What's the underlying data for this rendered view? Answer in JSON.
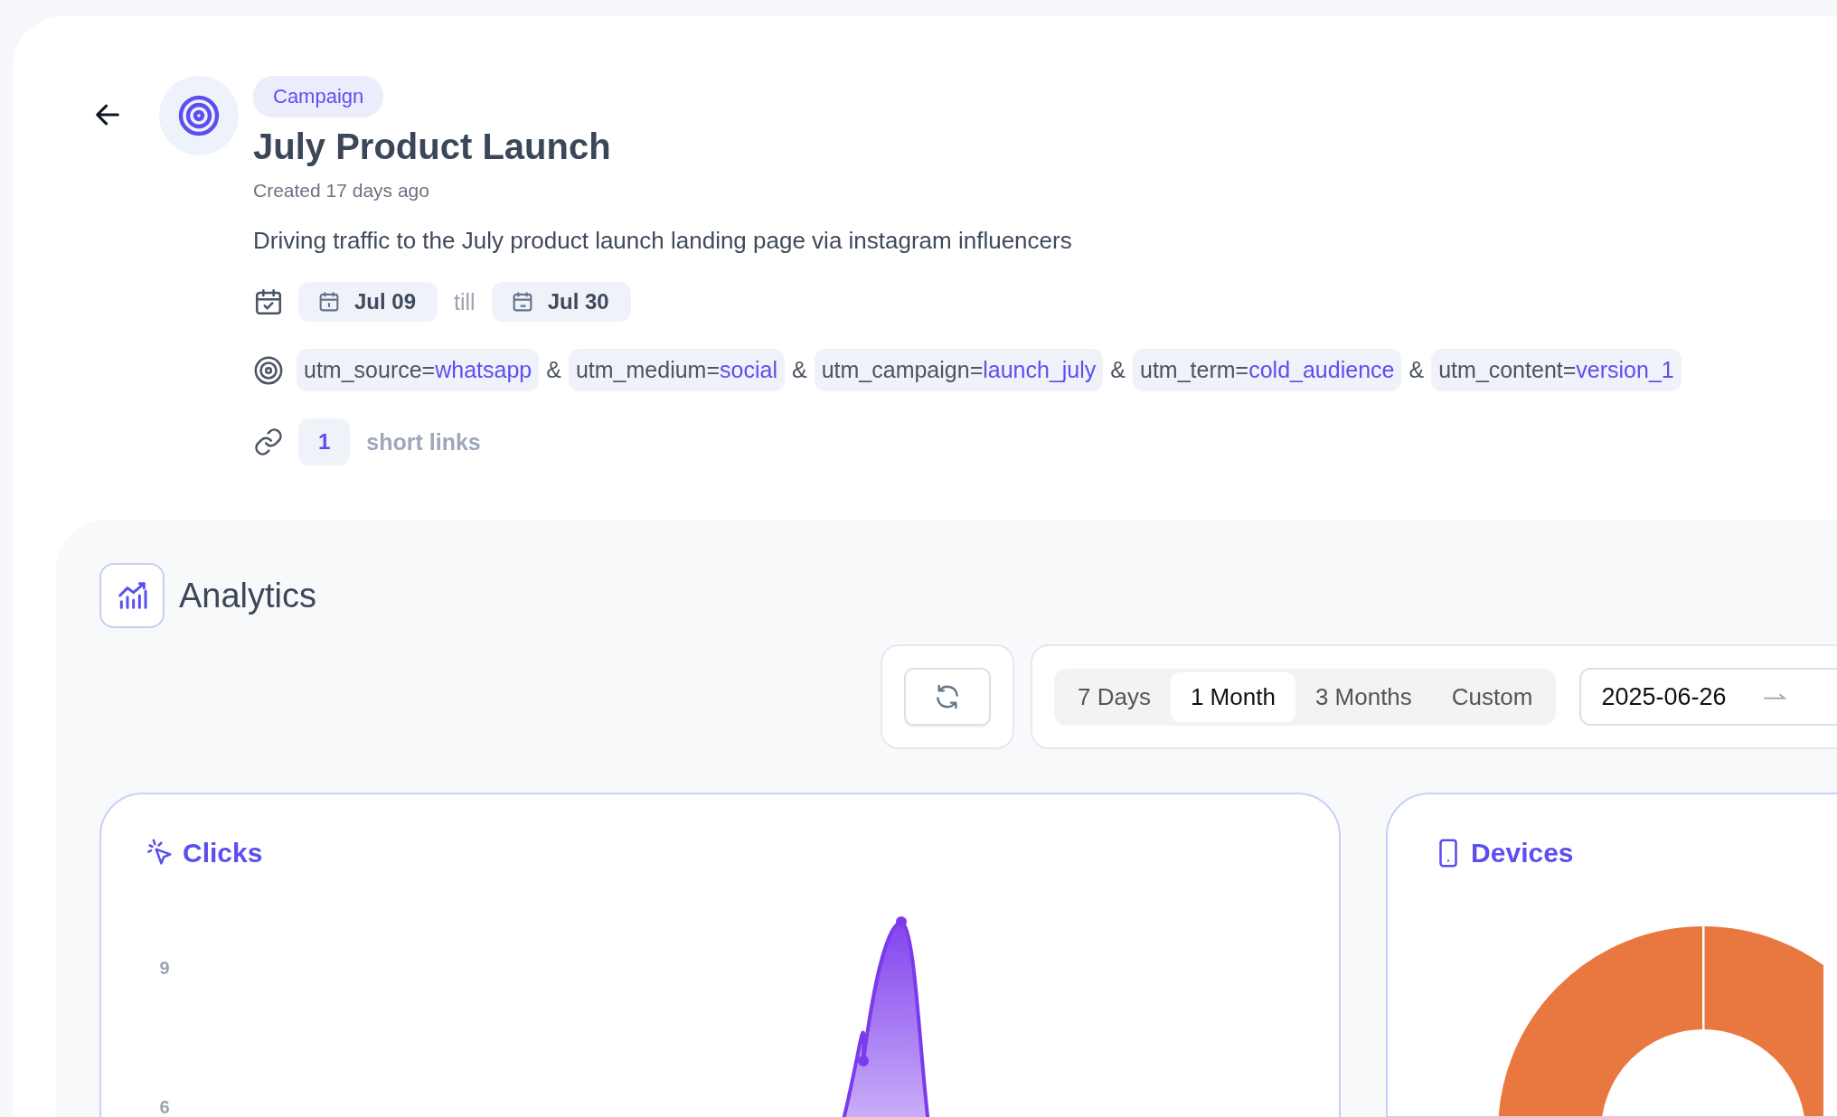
{
  "campaign": {
    "badge": "Campaign",
    "title": "July Product Launch",
    "created": "Created 17 days ago",
    "description": "Driving traffic to the July product launch landing page via instagram influencers",
    "dates": {
      "start": "Jul 09",
      "till": "till",
      "end": "Jul 30"
    },
    "utm_separator": "&",
    "utm": [
      {
        "key": "utm_source=",
        "value": "whatsapp"
      },
      {
        "key": "utm_medium=",
        "value": "social"
      },
      {
        "key": "utm_campaign=",
        "value": "launch_july"
      },
      {
        "key": "utm_term=",
        "value": "cold_audience"
      },
      {
        "key": "utm_content=",
        "value": "version_1"
      }
    ],
    "short_links": {
      "count": "1",
      "label": "short links"
    }
  },
  "analytics": {
    "title": "Analytics",
    "range_tabs": [
      {
        "label": "7 Days",
        "selected": false
      },
      {
        "label": "1 Month",
        "selected": true
      },
      {
        "label": "3 Months",
        "selected": false
      },
      {
        "label": "Custom",
        "selected": false
      }
    ],
    "date_from": "2025-06-26",
    "clicks": {
      "title": "Clicks",
      "y_axis_labels": [
        "9",
        "6"
      ]
    },
    "devices": {
      "title": "Devices"
    }
  }
}
